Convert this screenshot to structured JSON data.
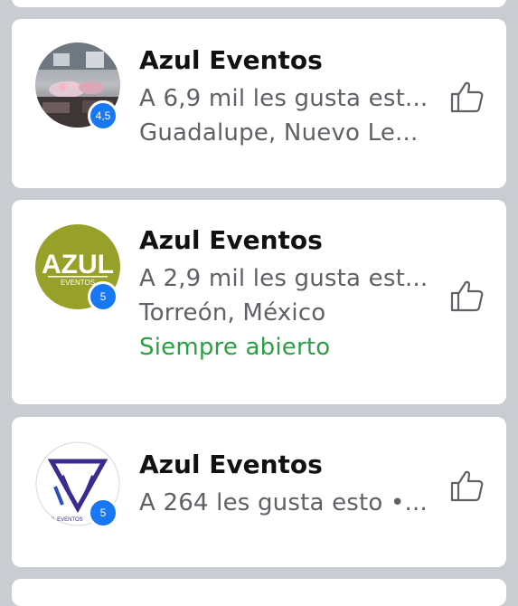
{
  "results": [
    {
      "title": "Azul Eventos",
      "rating": "4,5",
      "likes_text": "A 6,9 mil les gusta est...",
      "location": "Guadalupe, Nuevo Le...",
      "status": ""
    },
    {
      "title": "Azul Eventos",
      "rating": "5",
      "logo_text": "AZUL",
      "logo_subtext": "EVENTOS",
      "likes_text": "A 2,9 mil les gusta est...",
      "location": "Torreón, México",
      "status": "Siempre abierto"
    },
    {
      "title": "Azul Eventos",
      "rating": "5",
      "logo_subtext": "AZUL EVENTOS",
      "likes_text": "A 264 les gusta esto •...",
      "location": "",
      "status": ""
    }
  ],
  "colors": {
    "badge": "#1877f2",
    "status_open": "#2e9e45",
    "background": "#c9ccd1"
  },
  "icons": {
    "like": "thumbs-up-icon"
  }
}
